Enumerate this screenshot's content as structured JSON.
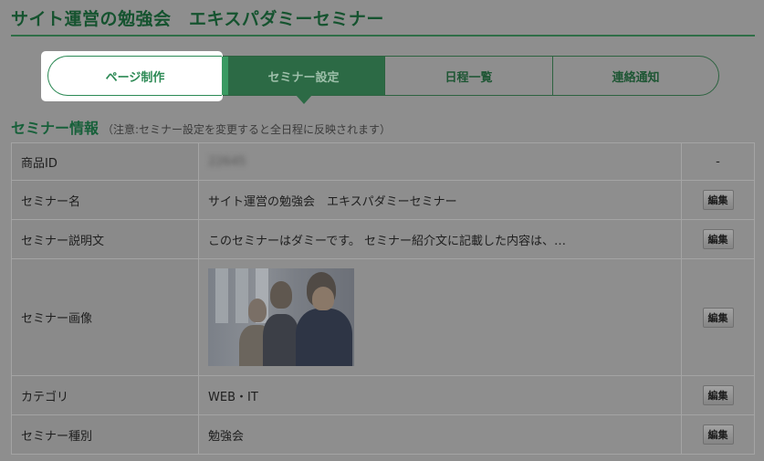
{
  "page": {
    "title": "サイト運営の勉強会　エキスパダミーセミナー"
  },
  "tabs": [
    {
      "label": "ページ制作"
    },
    {
      "label": "セミナー設定"
    },
    {
      "label": "日程一覧"
    },
    {
      "label": "連絡通知"
    }
  ],
  "section": {
    "title": "セミナー情報",
    "note": "（注意:セミナー設定を変更すると全日程に反映されます）"
  },
  "rows": [
    {
      "label": "商品ID",
      "value": "22645",
      "action": "-"
    },
    {
      "label": "セミナー名",
      "value": "サイト運営の勉強会　エキスパダミーセミナー",
      "action": "編集"
    },
    {
      "label": "セミナー説明文",
      "value": "このセミナーはダミーです。 セミナー紹介文に記載した内容は、…",
      "action": "編集"
    },
    {
      "label": "セミナー画像",
      "value": "",
      "action": "編集"
    },
    {
      "label": "カテゴリ",
      "value": "WEB・IT",
      "action": "編集"
    },
    {
      "label": "セミナー種別",
      "value": "勉強会",
      "action": "編集"
    }
  ],
  "colors": {
    "accent": "#2c6a45",
    "highlight": "#3a9a62"
  }
}
